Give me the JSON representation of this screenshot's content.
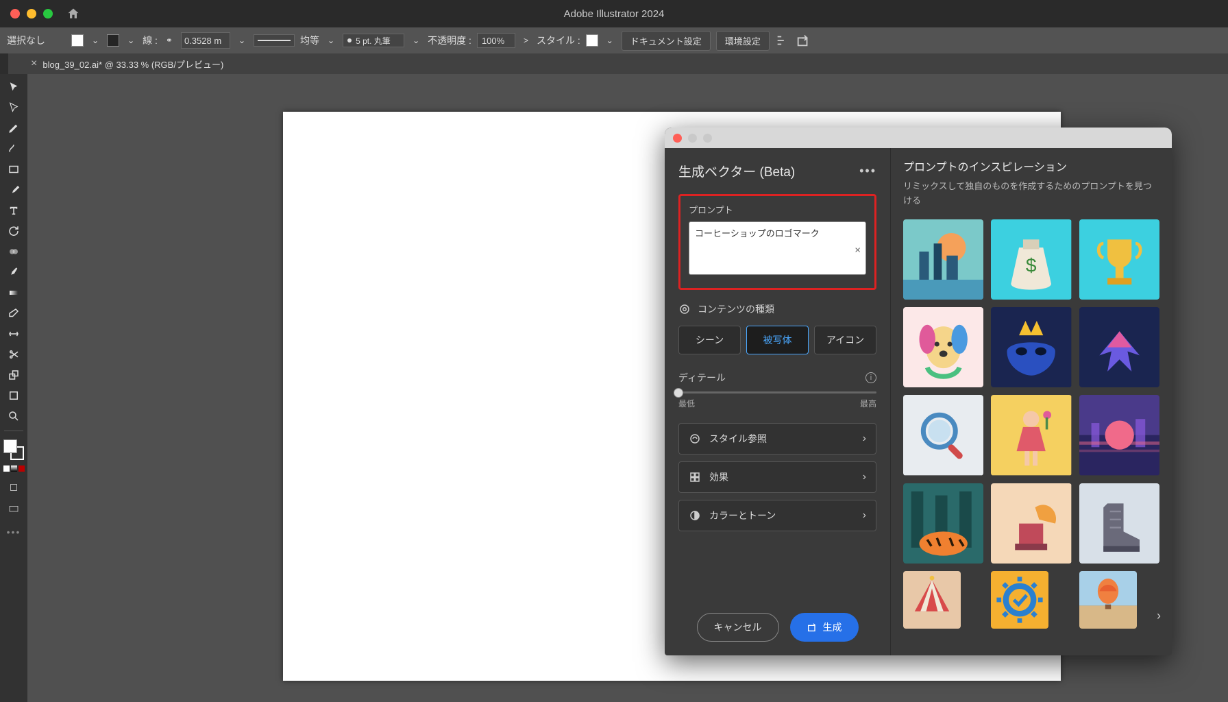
{
  "app_title": "Adobe Illustrator 2024",
  "controlbar": {
    "selection": "選択なし",
    "stroke_label": "線 :",
    "stroke_width": "0.3528 m",
    "stroke_uniform": "均等",
    "brush": "5 pt. 丸筆",
    "opacity_label": "不透明度 :",
    "opacity_value": "100%",
    "style_label": "スタイル :",
    "doc_setup": "ドキュメント設定",
    "env_setup": "環境設定"
  },
  "tab": {
    "name": "blog_39_02.ai* @ 33.33 % (RGB/プレビュー)"
  },
  "panel": {
    "title": "生成ベクター (Beta)",
    "prompt_label": "プロンプト",
    "prompt_value": "コーヒーショップのロゴマーク",
    "content_type_label": "コンテンツの種類",
    "content_types": {
      "scene": "シーン",
      "subject": "被写体",
      "icon": "アイコン"
    },
    "detail_label": "ディテール",
    "detail_min": "最低",
    "detail_max": "最高",
    "style_ref": "スタイル参照",
    "effects": "効果",
    "color_tone": "カラーとトーン",
    "cancel": "キャンセル",
    "generate": "生成",
    "insp_title": "プロンプトのインスピレーション",
    "insp_sub": "リミックスして独自のものを作成するためのプロンプトを見つける"
  }
}
